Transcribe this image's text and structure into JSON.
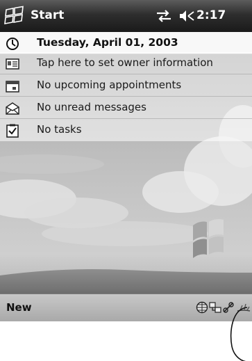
{
  "titlebar": {
    "start_label": "Start",
    "time": "2:17",
    "icons": [
      "windows-flag-icon",
      "connectivity-arrows-icon",
      "speaker-volume-icon"
    ]
  },
  "today": {
    "date": "Tuesday, April 01, 2003",
    "owner": "Tap here to set owner information",
    "appointments": "No upcoming appointments",
    "messages": "No unread messages",
    "tasks": "No tasks",
    "icons": [
      "clock-icon",
      "owner-card-icon",
      "calendar-icon",
      "envelope-icon",
      "task-checkbox-icon"
    ]
  },
  "command_bar": {
    "new_label": "New",
    "tray_icons": [
      "globe-network-icon",
      "device-sync-icon",
      "connection-link-icon",
      "power-tray-icon"
    ]
  },
  "colors": {
    "titlebar": "#2e2e2e",
    "command_bar": "#b8b8b8",
    "wallpaper_sky": "#cfcfcf"
  }
}
